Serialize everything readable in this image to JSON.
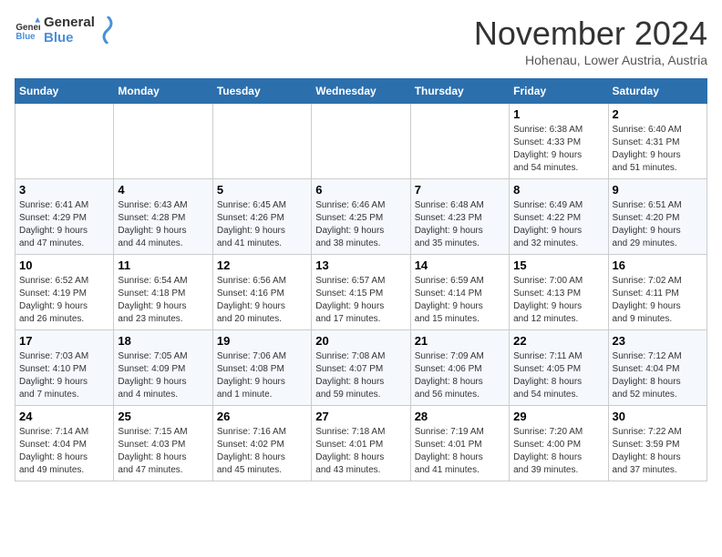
{
  "header": {
    "logo_line1": "General",
    "logo_line2": "Blue",
    "month_title": "November 2024",
    "location": "Hohenau, Lower Austria, Austria"
  },
  "weekdays": [
    "Sunday",
    "Monday",
    "Tuesday",
    "Wednesday",
    "Thursday",
    "Friday",
    "Saturday"
  ],
  "weeks": [
    [
      {
        "day": "",
        "info": ""
      },
      {
        "day": "",
        "info": ""
      },
      {
        "day": "",
        "info": ""
      },
      {
        "day": "",
        "info": ""
      },
      {
        "day": "",
        "info": ""
      },
      {
        "day": "1",
        "info": "Sunrise: 6:38 AM\nSunset: 4:33 PM\nDaylight: 9 hours\nand 54 minutes."
      },
      {
        "day": "2",
        "info": "Sunrise: 6:40 AM\nSunset: 4:31 PM\nDaylight: 9 hours\nand 51 minutes."
      }
    ],
    [
      {
        "day": "3",
        "info": "Sunrise: 6:41 AM\nSunset: 4:29 PM\nDaylight: 9 hours\nand 47 minutes."
      },
      {
        "day": "4",
        "info": "Sunrise: 6:43 AM\nSunset: 4:28 PM\nDaylight: 9 hours\nand 44 minutes."
      },
      {
        "day": "5",
        "info": "Sunrise: 6:45 AM\nSunset: 4:26 PM\nDaylight: 9 hours\nand 41 minutes."
      },
      {
        "day": "6",
        "info": "Sunrise: 6:46 AM\nSunset: 4:25 PM\nDaylight: 9 hours\nand 38 minutes."
      },
      {
        "day": "7",
        "info": "Sunrise: 6:48 AM\nSunset: 4:23 PM\nDaylight: 9 hours\nand 35 minutes."
      },
      {
        "day": "8",
        "info": "Sunrise: 6:49 AM\nSunset: 4:22 PM\nDaylight: 9 hours\nand 32 minutes."
      },
      {
        "day": "9",
        "info": "Sunrise: 6:51 AM\nSunset: 4:20 PM\nDaylight: 9 hours\nand 29 minutes."
      }
    ],
    [
      {
        "day": "10",
        "info": "Sunrise: 6:52 AM\nSunset: 4:19 PM\nDaylight: 9 hours\nand 26 minutes."
      },
      {
        "day": "11",
        "info": "Sunrise: 6:54 AM\nSunset: 4:18 PM\nDaylight: 9 hours\nand 23 minutes."
      },
      {
        "day": "12",
        "info": "Sunrise: 6:56 AM\nSunset: 4:16 PM\nDaylight: 9 hours\nand 20 minutes."
      },
      {
        "day": "13",
        "info": "Sunrise: 6:57 AM\nSunset: 4:15 PM\nDaylight: 9 hours\nand 17 minutes."
      },
      {
        "day": "14",
        "info": "Sunrise: 6:59 AM\nSunset: 4:14 PM\nDaylight: 9 hours\nand 15 minutes."
      },
      {
        "day": "15",
        "info": "Sunrise: 7:00 AM\nSunset: 4:13 PM\nDaylight: 9 hours\nand 12 minutes."
      },
      {
        "day": "16",
        "info": "Sunrise: 7:02 AM\nSunset: 4:11 PM\nDaylight: 9 hours\nand 9 minutes."
      }
    ],
    [
      {
        "day": "17",
        "info": "Sunrise: 7:03 AM\nSunset: 4:10 PM\nDaylight: 9 hours\nand 7 minutes."
      },
      {
        "day": "18",
        "info": "Sunrise: 7:05 AM\nSunset: 4:09 PM\nDaylight: 9 hours\nand 4 minutes."
      },
      {
        "day": "19",
        "info": "Sunrise: 7:06 AM\nSunset: 4:08 PM\nDaylight: 9 hours\nand 1 minute."
      },
      {
        "day": "20",
        "info": "Sunrise: 7:08 AM\nSunset: 4:07 PM\nDaylight: 8 hours\nand 59 minutes."
      },
      {
        "day": "21",
        "info": "Sunrise: 7:09 AM\nSunset: 4:06 PM\nDaylight: 8 hours\nand 56 minutes."
      },
      {
        "day": "22",
        "info": "Sunrise: 7:11 AM\nSunset: 4:05 PM\nDaylight: 8 hours\nand 54 minutes."
      },
      {
        "day": "23",
        "info": "Sunrise: 7:12 AM\nSunset: 4:04 PM\nDaylight: 8 hours\nand 52 minutes."
      }
    ],
    [
      {
        "day": "24",
        "info": "Sunrise: 7:14 AM\nSunset: 4:04 PM\nDaylight: 8 hours\nand 49 minutes."
      },
      {
        "day": "25",
        "info": "Sunrise: 7:15 AM\nSunset: 4:03 PM\nDaylight: 8 hours\nand 47 minutes."
      },
      {
        "day": "26",
        "info": "Sunrise: 7:16 AM\nSunset: 4:02 PM\nDaylight: 8 hours\nand 45 minutes."
      },
      {
        "day": "27",
        "info": "Sunrise: 7:18 AM\nSunset: 4:01 PM\nDaylight: 8 hours\nand 43 minutes."
      },
      {
        "day": "28",
        "info": "Sunrise: 7:19 AM\nSunset: 4:01 PM\nDaylight: 8 hours\nand 41 minutes."
      },
      {
        "day": "29",
        "info": "Sunrise: 7:20 AM\nSunset: 4:00 PM\nDaylight: 8 hours\nand 39 minutes."
      },
      {
        "day": "30",
        "info": "Sunrise: 7:22 AM\nSunset: 3:59 PM\nDaylight: 8 hours\nand 37 minutes."
      }
    ]
  ]
}
